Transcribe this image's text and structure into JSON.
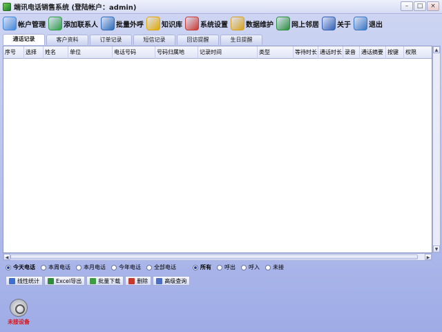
{
  "window": {
    "title": "端讯电话销售系统 (登陆帐户：admin)",
    "controls": [
      "–",
      "□",
      "×"
    ]
  },
  "toolbar": [
    {
      "label": "帐户管理",
      "icon": "users-icon",
      "color": "#3f86d9"
    },
    {
      "label": "添加联系人",
      "icon": "add-contact-icon",
      "color": "#2e9c45"
    },
    {
      "label": "批量外呼",
      "icon": "batch-call-icon",
      "color": "#2a6ab8"
    },
    {
      "label": "知识库",
      "icon": "help-book-icon",
      "color": "#e0a800"
    },
    {
      "label": "系统设置",
      "icon": "tools-icon",
      "color": "#c9392f"
    },
    {
      "label": "数据维护",
      "icon": "database-icon",
      "color": "#d7a21a"
    },
    {
      "label": "网上邻居",
      "icon": "globe-icon",
      "color": "#2a8e3b"
    },
    {
      "label": "关于",
      "icon": "question-icon",
      "color": "#3160b5"
    },
    {
      "label": "退出",
      "icon": "exit-door-icon",
      "color": "#3776c1"
    }
  ],
  "tabs": [
    "通话记录",
    "客户资料",
    "订单记录",
    "短信记录",
    "回访提醒",
    "生日提醒"
  ],
  "active_tab": 0,
  "grid": {
    "columns": [
      "序号",
      "选择",
      "姓名",
      "单位",
      "电话号码",
      "号码归属地",
      "记录时间",
      "类型",
      "等待时长",
      "通话时长",
      "录音",
      "通话摘要",
      "按键",
      "权限"
    ]
  },
  "filters": {
    "period": [
      "今天电话",
      "本周电话",
      "本月电话",
      "今年电话",
      "全部电话"
    ],
    "period_selected": 0,
    "direction": [
      "所有",
      "呼出",
      "呼入",
      "未接"
    ],
    "direction_selected": 0
  },
  "actions": [
    {
      "label": "线性统计",
      "icon": "chart-icon",
      "color": "#3c6fd1"
    },
    {
      "label": "Excel导出",
      "icon": "excel-icon",
      "color": "#2f8a3a"
    },
    {
      "label": "批量下载",
      "icon": "download-icon",
      "color": "#3f9c43"
    },
    {
      "label": "删除",
      "icon": "delete-icon",
      "color": "#c23a2e"
    },
    {
      "label": "高级查询",
      "icon": "search-icon",
      "color": "#4d6dbf"
    }
  ],
  "device": {
    "status": "未接设备"
  }
}
